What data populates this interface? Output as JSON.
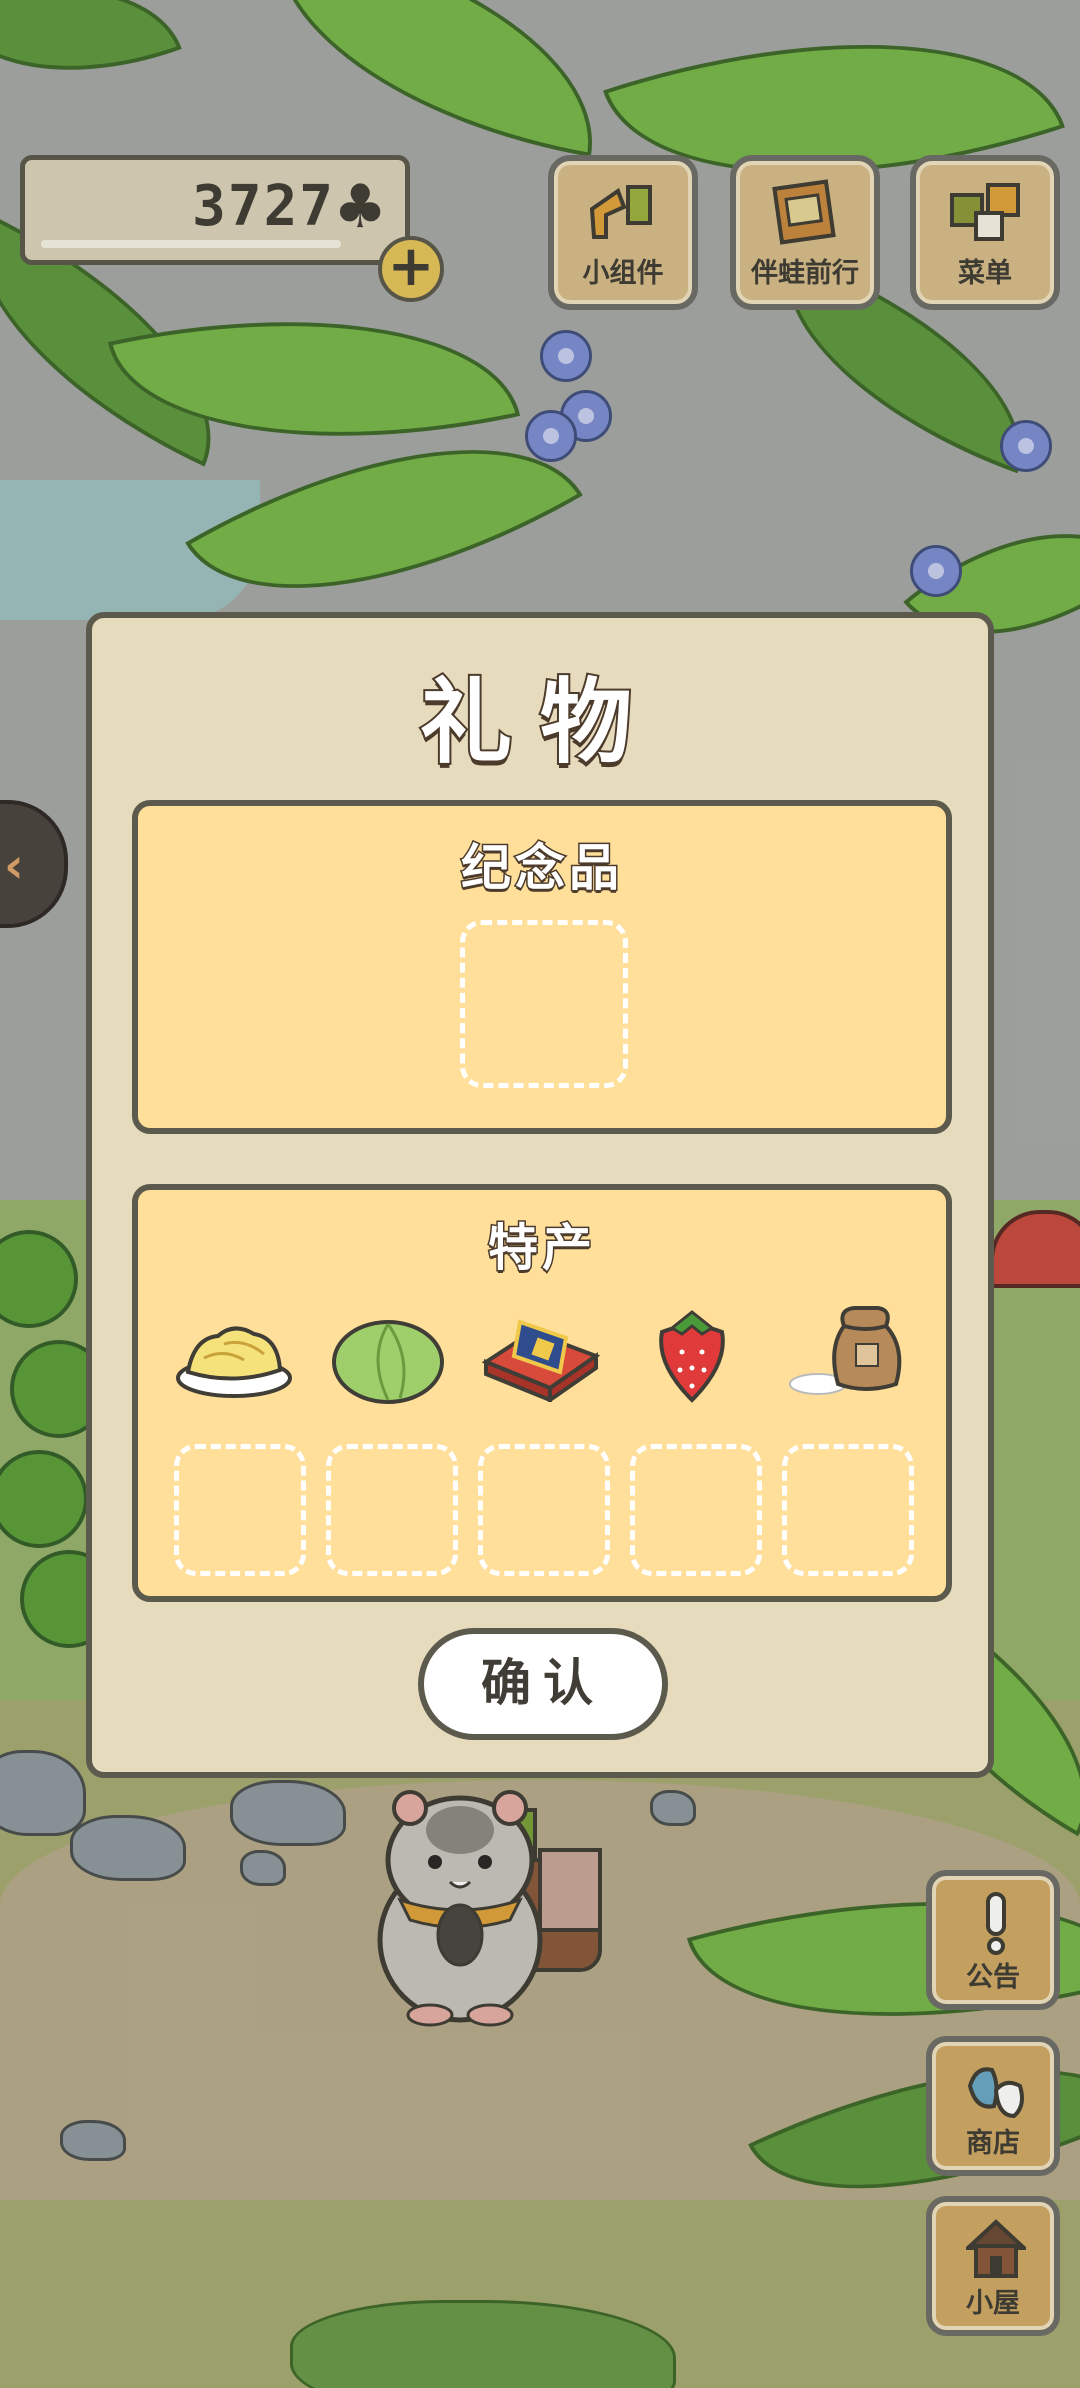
{
  "hud": {
    "clover_count": "3727",
    "clover_symbol": "♣",
    "plus_symbol": "+",
    "buttons": [
      {
        "label": "小组件",
        "icon": "widget-icon"
      },
      {
        "label": "伴蛙前行",
        "icon": "photo-album-icon"
      },
      {
        "label": "菜单",
        "icon": "menu-icon"
      }
    ]
  },
  "side": {
    "back_symbol": "‹",
    "buttons": [
      {
        "label": "公告",
        "icon": "exclamation-icon"
      },
      {
        "label": "商店",
        "icon": "shop-bags-icon"
      },
      {
        "label": "小屋",
        "icon": "house-icon"
      }
    ]
  },
  "dialog": {
    "title": "礼物",
    "souvenir": {
      "title": "纪念品",
      "slots": 1
    },
    "specialty": {
      "title": "特产",
      "items": [
        {
          "name": "fried-noodles-icon"
        },
        {
          "name": "cabbage-icon"
        },
        {
          "name": "snack-box-icon"
        },
        {
          "name": "strawberry-icon"
        },
        {
          "name": "rice-bag-icon"
        }
      ],
      "slots": 5
    },
    "confirm_label": "确认"
  },
  "colors": {
    "dialog_bg": "#e6dbbd",
    "panel_bg": "#ffdf99",
    "border": "#5c5a4c",
    "button_wood": "#d2ab66"
  }
}
